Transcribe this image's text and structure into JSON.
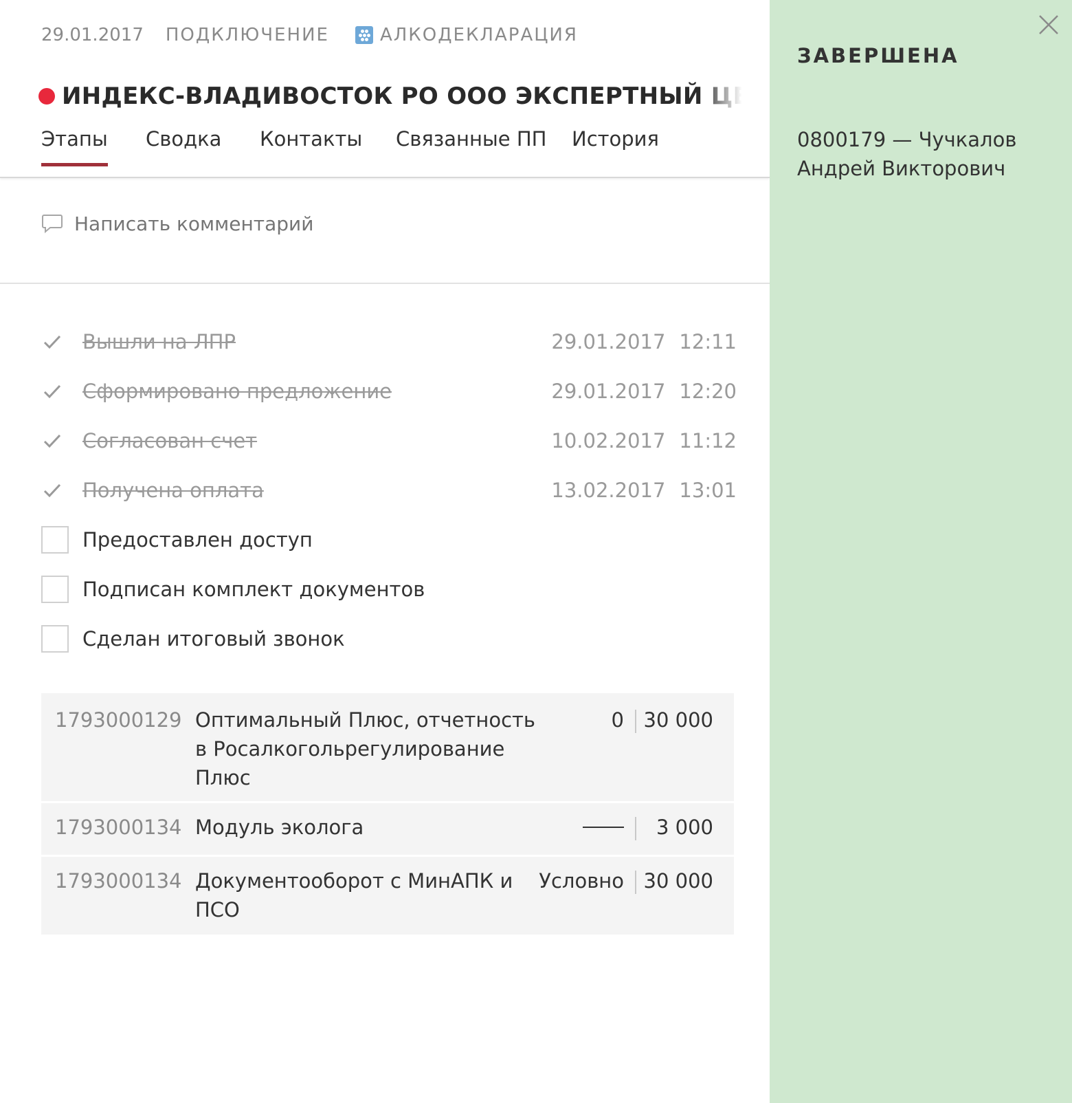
{
  "header": {
    "date": "29.01.2017",
    "type": "ПОДКЛЮЧЕНИЕ",
    "product": "АЛКОДЕКЛАРАЦИЯ",
    "title": "ИНДЕКС-ВЛАДИВОСТОК РО ООО ЭКСПЕРТНЫЙ ЦЕНТР ИН",
    "status_color": "#e8283c"
  },
  "tabs": [
    {
      "label": "Этапы",
      "active": true
    },
    {
      "label": "Сводка",
      "active": false
    },
    {
      "label": "Контакты",
      "active": false
    },
    {
      "label": "Связанные ПП",
      "active": false
    },
    {
      "label": "История",
      "active": false
    }
  ],
  "comment": {
    "placeholder": "Написать комментарий"
  },
  "stages_done": [
    {
      "label": "Вышли на ЛПР",
      "date": "29.01.2017",
      "time": "12:11"
    },
    {
      "label": "Сформировано предложение",
      "date": "29.01.2017",
      "time": "12:20"
    },
    {
      "label": "Согласован счет",
      "date": "10.02.2017",
      "time": "11:12"
    },
    {
      "label": "Получена оплата",
      "date": "13.02.2017",
      "time": "13:01"
    }
  ],
  "stages_todo": [
    {
      "label": "Предоставлен доступ"
    },
    {
      "label": "Подписан комплект документов"
    },
    {
      "label": "Сделан итоговый звонок"
    }
  ],
  "products": [
    {
      "code": "1793000129",
      "name": "Оптимальный Плюс, отчетность в Росалкогольрегулирование Плюс",
      "qty": "0",
      "price": "30 000"
    },
    {
      "code": "1793000134",
      "name": "Модуль эколога",
      "qty": "",
      "price": "3 000"
    },
    {
      "code": "1793000134",
      "name": "Документооборот с МинАПК и ПСО",
      "qty": "Условно",
      "price": "30 000"
    }
  ],
  "side": {
    "status": "ЗАВЕРШЕНА",
    "person": "0800179 — Чучкалов Андрей Викторович",
    "background": "#cfe8cf"
  }
}
